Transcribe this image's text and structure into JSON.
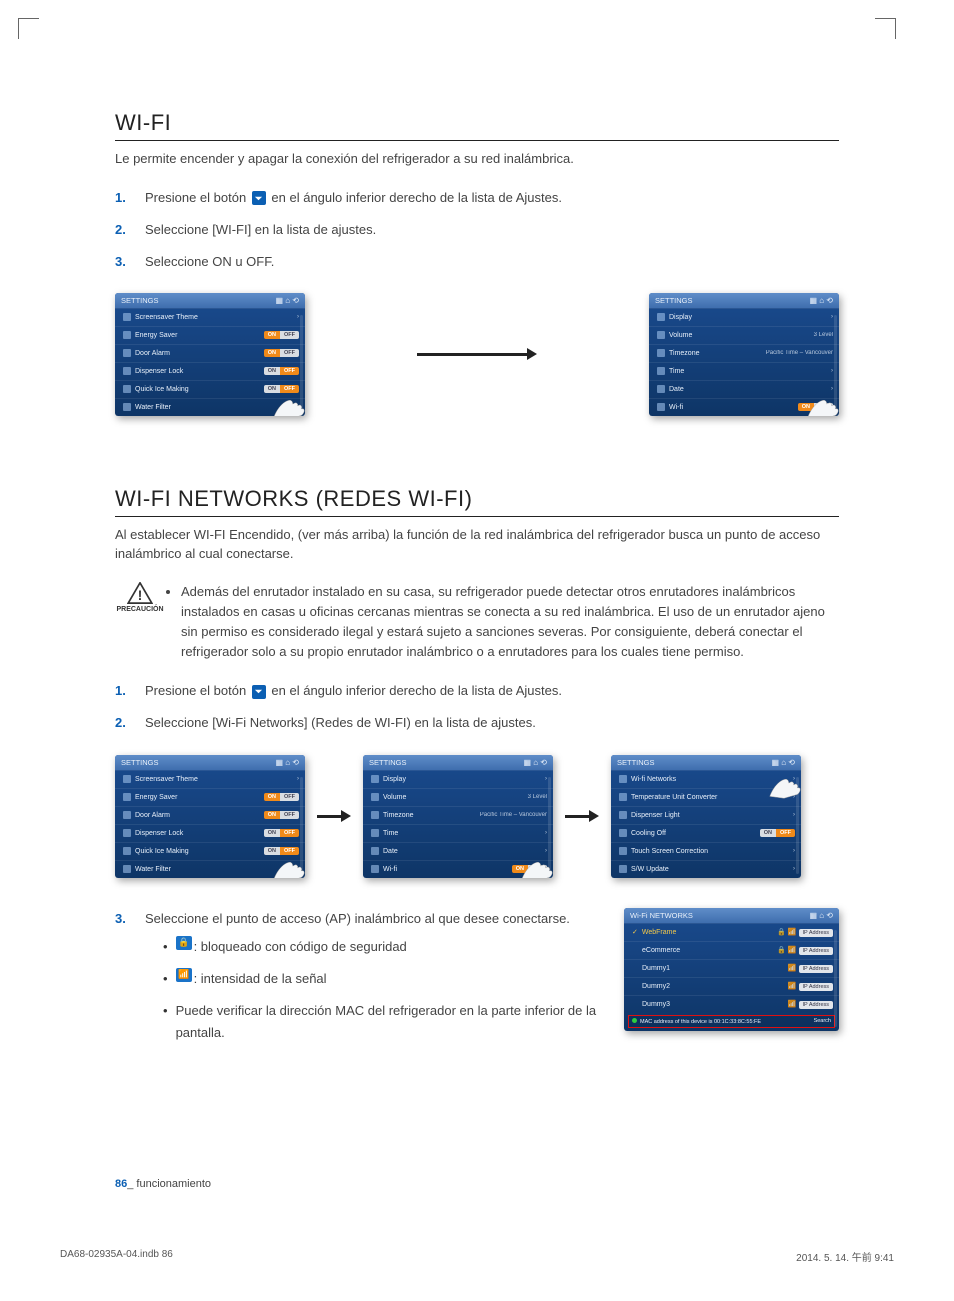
{
  "section1": {
    "title": "WI-FI",
    "desc": "Le permite encender y apagar la conexión del refrigerador a su red inalámbrica.",
    "steps": [
      {
        "n": "1.",
        "pre": "Presione el botón ",
        "post": " en el ángulo inferior derecho de la lista de Ajustes."
      },
      {
        "n": "2.",
        "text": "Seleccione [WI-FI] en la lista de ajustes."
      },
      {
        "n": "3.",
        "text": "Seleccione ON u OFF."
      }
    ]
  },
  "section2": {
    "title": "WI-FI NETWORKS (REDES WI-FI)",
    "desc": "Al establecer WI-FI Encendido, (ver más arriba) la función de la red inalámbrica del refrigerador busca un punto de acceso inalámbrico al cual conectarse.",
    "caution_label": "PRECAUCIÓN",
    "caution": "Además del enrutador instalado en su casa, su refrigerador puede detectar otros enrutadores inalámbricos instalados en casas u oficinas cercanas mientras se conecta a su red inalámbrica. El uso de un enrutador ajeno sin permiso es considerado ilegal y estará sujeto a sanciones severas. Por consiguiente, deberá conectar el refrigerador solo a su propio enrutador inalámbrico o a enrutadores para los cuales tiene permiso.",
    "steps_a": [
      {
        "n": "1.",
        "pre": "Presione el botón ",
        "post": " en el ángulo inferior derecho de la lista de Ajustes."
      },
      {
        "n": "2.",
        "text": "Seleccione [Wi-Fi Networks] (Redes de WI-FI) en la lista de ajustes."
      }
    ],
    "step3": {
      "n": "3.",
      "text": "Seleccione el punto de acceso (AP) inalámbrico al que desee conectarse."
    },
    "legend": [
      ": bloqueado con código de seguridad",
      ": intensidad de la señal",
      "Puede verificar la dirección MAC del refrigerador en la parte inferior de la pantalla."
    ]
  },
  "screens": {
    "settings_title": "SETTINGS",
    "toggle_on": "ON",
    "toggle_off": "OFF",
    "s1_items": [
      "Screensaver Theme",
      "Energy Saver",
      "Door Alarm",
      "Dispenser Lock",
      "Quick Ice Making",
      "Water Filter"
    ],
    "s2_items": [
      "Display",
      "Volume",
      "Timezone",
      "Time",
      "Date",
      "Wi-fi"
    ],
    "s2_vol": "3 Level",
    "s2_tz": "Pacific Time – Vancouver",
    "s3_items": [
      "Wi-fi Networks",
      "Temperature Unit Converter",
      "Dispenser Light",
      "Cooling Off",
      "Touch Screen Correction",
      "S/W Update"
    ],
    "net_title": "Wi-Fi NETWORKS",
    "net_items": [
      "WebFrame",
      "eCommerce",
      "Dummy1",
      "Dummy2",
      "Dummy3"
    ],
    "net_ip": "IP Address",
    "net_mac": "MAC address of this device is 00:1C:33:8C:55:FE",
    "net_search": "Search"
  },
  "footer": {
    "page_num": "86",
    "page_label": "_ funcionamiento",
    "indd": "DA68-02935A-04.indb   86",
    "date": "2014. 5. 14.   午前 9:41"
  }
}
